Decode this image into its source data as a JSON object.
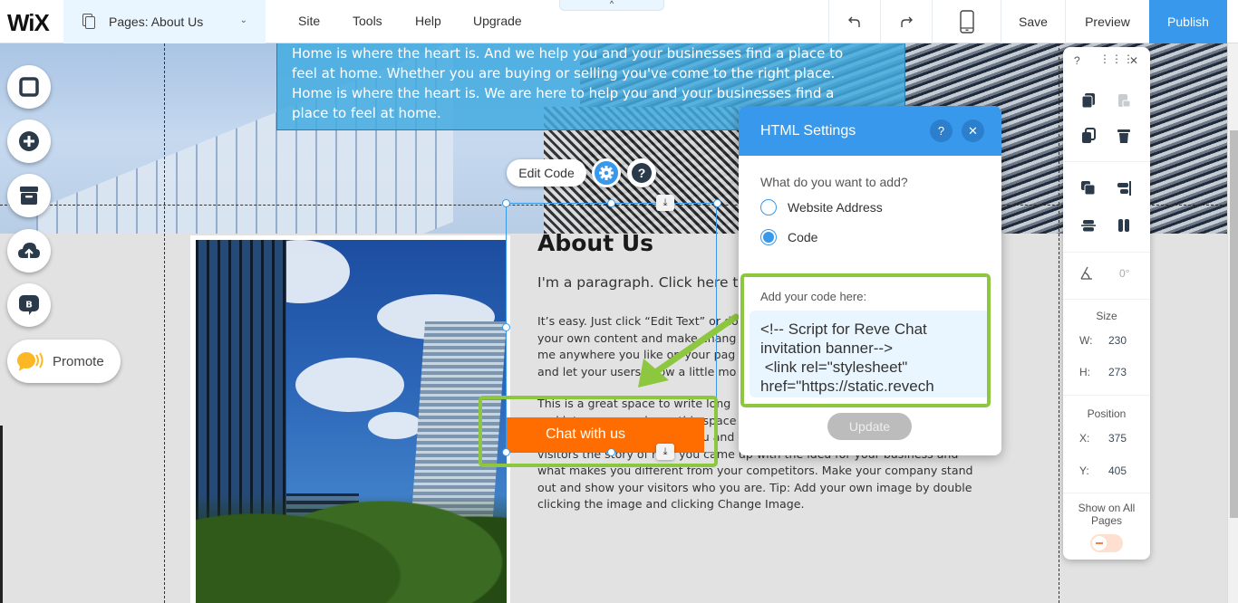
{
  "topbar": {
    "logo": "WiX",
    "pages_dropdown": "Pages: About Us",
    "menu": [
      "Site",
      "Tools",
      "Help",
      "Upgrade"
    ],
    "save": "Save",
    "preview": "Preview",
    "publish": "Publish",
    "collapse_glyph": "^"
  },
  "hero": {
    "text": "Home is where the heart is. And we help you and your businesses find a place to feel at home. Whether you are buying or selling you've come to the right place. Home is where the heart is. We  are here to help you and your businesses find a place to feel at home.",
    "lines": [
      "Home is where the heart is. And we help you and your businesses find a place to",
      "feel at home. Whether you are buying or selling you've come to the right place.",
      "Home is where the heart is. We  are here to help you and your businesses find a",
      "place to feel at home."
    ]
  },
  "left_tools": {
    "items": [
      "background-icon",
      "add-icon",
      "store-icon",
      "upload-icon",
      "blog-icon"
    ],
    "promote": "Promote"
  },
  "content": {
    "title": "About Us",
    "para1": "I'm a paragraph. Click here to",
    "para2_lines": [
      "It’s easy. Just click “Edit Text” or do",
      "your own content and make chang",
      "me anywhere you like on your pag",
      "and let your users know a little mo"
    ],
    "para3_lines": [
      "This is a great space to write long",
      "and let your users know this space to",
      "what your team and what you and your team ar",
      "visitors the story of how you came up with the idea for your business and",
      "what makes you different from your competitors. Make your company stand",
      "out and show your visitors who you are. Tip: Add your own image by double",
      "clicking the image and clicking Change Image."
    ]
  },
  "floating": {
    "edit_code": "Edit Code",
    "help": "?"
  },
  "chat_button": "Chat with us",
  "html_settings": {
    "title": "HTML Settings",
    "help": "?",
    "close": "✕",
    "question": "What do you want to add?",
    "options": [
      {
        "label": "Website Address",
        "selected": false
      },
      {
        "label": "Code",
        "selected": true
      }
    ],
    "code_label": "Add your code here:",
    "code_value": "<!-- Script for Reve Chat\ninvitation banner-->\n <link rel=\"stylesheet\"\nhref=\"https://static.revech",
    "update": "Update"
  },
  "properties": {
    "help": "?",
    "close": "✕",
    "rotation": "0°",
    "size_label": "Size",
    "w_label": "W:",
    "w": "230",
    "h_label": "H:",
    "h": "273",
    "position_label": "Position",
    "x_label": "X:",
    "x": "375",
    "y_label": "Y:",
    "y": "405",
    "show_all_pages": "Show on All Pages",
    "show_all_pages_on": false
  },
  "colors": {
    "accent": "#3899ec",
    "publish": "#3899ec",
    "chat_button": "#ff6d00",
    "highlight": "#8dc63f"
  }
}
